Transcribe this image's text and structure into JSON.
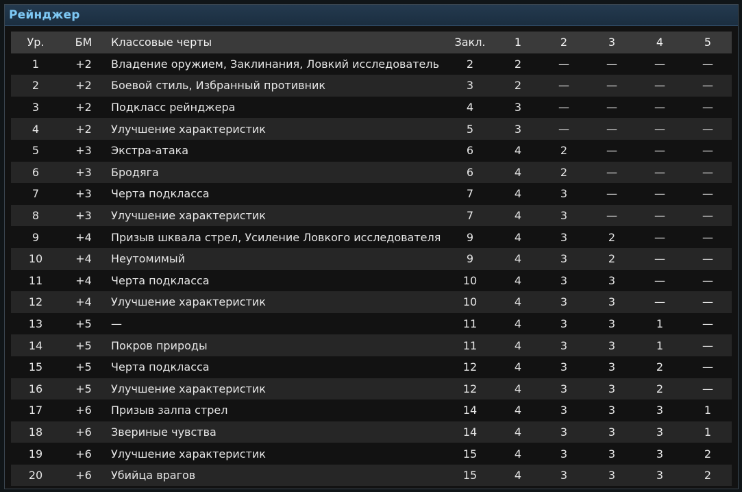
{
  "window": {
    "title": "Рейнджер"
  },
  "table": {
    "headers": [
      "Ур.",
      "БМ",
      "Классовые черты",
      "Закл.",
      "1",
      "2",
      "3",
      "4",
      "5"
    ],
    "rows": [
      [
        "1",
        "+2",
        "Владение оружием, Заклинания, Ловкий исследователь",
        "2",
        "2",
        "—",
        "—",
        "—",
        "—"
      ],
      [
        "2",
        "+2",
        "Боевой стиль, Избранный противник",
        "3",
        "2",
        "—",
        "—",
        "—",
        "—"
      ],
      [
        "3",
        "+2",
        "Подкласс рейнджера",
        "4",
        "3",
        "—",
        "—",
        "—",
        "—"
      ],
      [
        "4",
        "+2",
        "Улучшение характеристик",
        "5",
        "3",
        "—",
        "—",
        "—",
        "—"
      ],
      [
        "5",
        "+3",
        "Экстра-атака",
        "6",
        "4",
        "2",
        "—",
        "—",
        "—"
      ],
      [
        "6",
        "+3",
        "Бродяга",
        "6",
        "4",
        "2",
        "—",
        "—",
        "—"
      ],
      [
        "7",
        "+3",
        "Черта подкласса",
        "7",
        "4",
        "3",
        "—",
        "—",
        "—"
      ],
      [
        "8",
        "+3",
        "Улучшение характеристик",
        "7",
        "4",
        "3",
        "—",
        "—",
        "—"
      ],
      [
        "9",
        "+4",
        "Призыв шквала стрел, Усиление Ловкого исследователя",
        "9",
        "4",
        "3",
        "2",
        "—",
        "—"
      ],
      [
        "10",
        "+4",
        "Неутомимый",
        "9",
        "4",
        "3",
        "2",
        "—",
        "—"
      ],
      [
        "11",
        "+4",
        "Черта подкласса",
        "10",
        "4",
        "3",
        "3",
        "—",
        "—"
      ],
      [
        "12",
        "+4",
        "Улучшение характеристик",
        "10",
        "4",
        "3",
        "3",
        "—",
        "—"
      ],
      [
        "13",
        "+5",
        "—",
        "11",
        "4",
        "3",
        "3",
        "1",
        "—"
      ],
      [
        "14",
        "+5",
        "Покров природы",
        "11",
        "4",
        "3",
        "3",
        "1",
        "—"
      ],
      [
        "15",
        "+5",
        "Черта подкласса",
        "12",
        "4",
        "3",
        "3",
        "2",
        "—"
      ],
      [
        "16",
        "+5",
        "Улучшение характеристик",
        "12",
        "4",
        "3",
        "3",
        "2",
        "—"
      ],
      [
        "17",
        "+6",
        "Призыв залпа стрел",
        "14",
        "4",
        "3",
        "3",
        "3",
        "1"
      ],
      [
        "18",
        "+6",
        "Звериные чувства",
        "14",
        "4",
        "3",
        "3",
        "3",
        "1"
      ],
      [
        "19",
        "+6",
        "Улучшение характеристик",
        "15",
        "4",
        "3",
        "3",
        "3",
        "2"
      ],
      [
        "20",
        "+6",
        "Убийца врагов",
        "15",
        "4",
        "3",
        "3",
        "3",
        "2"
      ]
    ]
  }
}
